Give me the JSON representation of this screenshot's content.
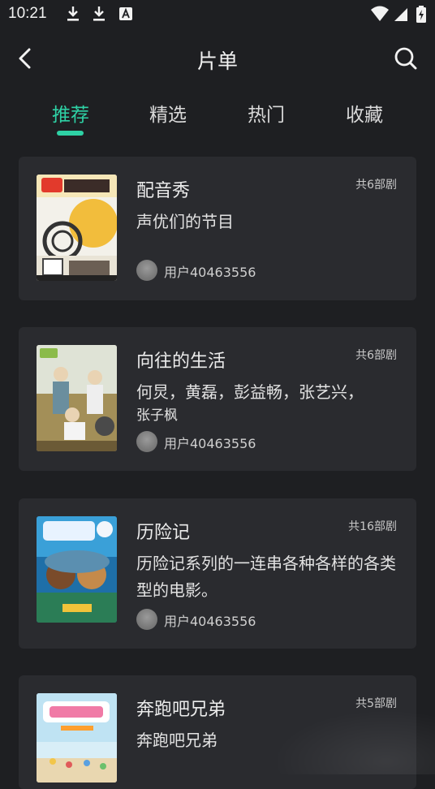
{
  "status_bar": {
    "time": "10:21",
    "icons": [
      "download-icon",
      "download-icon",
      "text-a-icon",
      "wifi-icon",
      "signal-icon",
      "battery-charging-icon"
    ]
  },
  "header": {
    "title": "片单",
    "back_icon": "chevron-left-icon",
    "search_icon": "search-icon"
  },
  "tabs": [
    {
      "label": "推荐",
      "active": true
    },
    {
      "label": "精选",
      "active": false
    },
    {
      "label": "热门",
      "active": false
    },
    {
      "label": "收藏",
      "active": false
    }
  ],
  "accent_color": "#2ed1a5",
  "cards": [
    {
      "title": "配音秀",
      "count": "共6部剧",
      "desc": "声优们的节目",
      "user": "用户40463556"
    },
    {
      "title": "向往的生活",
      "count": "共6部剧",
      "desc_line1": "何炅，黄磊，彭益畅，张艺兴，",
      "desc_line2": "张子枫",
      "user": "用户40463556"
    },
    {
      "title": "历险记",
      "count": "共16部剧",
      "desc": "历险记系列的一连串各种各样的各类型的电影。",
      "user": "用户40463556"
    },
    {
      "title": "奔跑吧兄弟",
      "count": "共5部剧",
      "desc": "奔跑吧兄弟"
    }
  ]
}
